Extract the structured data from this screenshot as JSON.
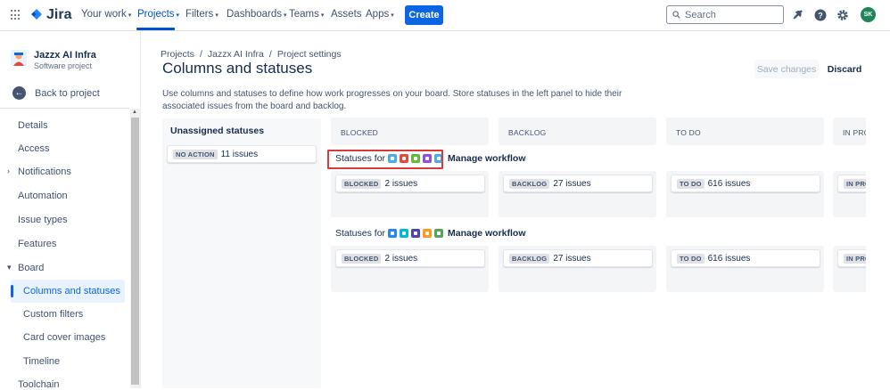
{
  "topnav": {
    "app_name": "Jira",
    "items": [
      {
        "label": "Your work"
      },
      {
        "label": "Projects"
      },
      {
        "label": "Filters"
      },
      {
        "label": "Dashboards"
      },
      {
        "label": "Teams"
      },
      {
        "label": "Assets"
      },
      {
        "label": "Apps"
      }
    ],
    "create_label": "Create",
    "search_placeholder": "Search",
    "avatar_initials": "SK",
    "accent_color": "#0c66e4"
  },
  "sidebar": {
    "project_name": "Jazzx AI Infra",
    "project_type": "Software project",
    "back_label": "Back to project",
    "items": [
      {
        "label": "Details"
      },
      {
        "label": "Access"
      },
      {
        "label": "Notifications"
      },
      {
        "label": "Automation"
      },
      {
        "label": "Issue types"
      },
      {
        "label": "Features"
      },
      {
        "label": "Board"
      },
      {
        "label": "Columns and statuses"
      },
      {
        "label": "Custom filters"
      },
      {
        "label": "Card cover images"
      },
      {
        "label": "Timeline"
      },
      {
        "label": "Toolchain"
      }
    ]
  },
  "main": {
    "breadcrumb": [
      "Projects",
      "Jazzx AI Infra",
      "Project settings"
    ],
    "title": "Columns and statuses",
    "save_label": "Save changes",
    "discard_label": "Discard",
    "description": "Use columns and statuses to define how work progresses on your board. Store statuses in the left panel to hide their associated issues from the board and backlog.",
    "unassigned": {
      "title": "Unassigned statuses",
      "status": "NO ACTION",
      "count": "11 issues"
    },
    "columns": [
      "BLOCKED",
      "BACKLOG",
      "TO DO",
      "IN PRO"
    ],
    "groups": [
      {
        "statuses_for": "Statuses for",
        "manage_label": "Manage workflow",
        "icon_colors": [
          "#4bade8",
          "#e5493a",
          "#63ba3c",
          "#904ee2",
          "#4bade8"
        ],
        "cells": [
          {
            "status": "BLOCKED",
            "count": "2 issues"
          },
          {
            "status": "BACKLOG",
            "count": "27 issues"
          },
          {
            "status": "TO DO",
            "count": "616 issues"
          },
          {
            "status": "IN PRO",
            "count": ""
          }
        ]
      },
      {
        "statuses_for": "Statuses for",
        "manage_label": "Manage workflow",
        "icon_colors": [
          "#2684ff",
          "#00b8d9",
          "#5243aa",
          "#ff991f",
          "#57a55a"
        ],
        "cells": [
          {
            "status": "BLOCKED",
            "count": "2 issues"
          },
          {
            "status": "BACKLOG",
            "count": "27 issues"
          },
          {
            "status": "TO DO",
            "count": "616 issues"
          },
          {
            "status": "IN PRO",
            "count": ""
          }
        ]
      }
    ]
  }
}
